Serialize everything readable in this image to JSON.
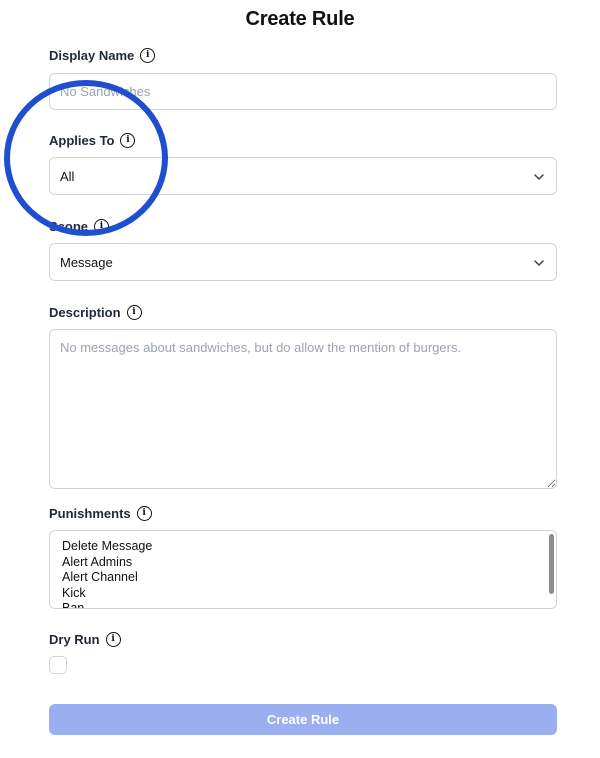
{
  "title": "Create Rule",
  "fields": {
    "display_name": {
      "label": "Display Name",
      "placeholder": "No Sandwiches",
      "value": ""
    },
    "applies_to": {
      "label": "Applies To",
      "value": "All"
    },
    "scope": {
      "label": "Scope",
      "value": "Message"
    },
    "description": {
      "label": "Description",
      "placeholder": "No messages about sandwiches, but do allow the mention of burgers."
    },
    "punishments": {
      "label": "Punishments",
      "options": [
        "Delete Message",
        "Alert Admins",
        "Alert Channel",
        "Kick",
        "Ban"
      ]
    },
    "dry_run": {
      "label": "Dry Run",
      "checked": false
    }
  },
  "submit_label": "Create Rule",
  "icons": {
    "info": "info-icon",
    "dropdown": "chevron-down-icon"
  },
  "colors": {
    "submit_bg": "#9aaef0",
    "annotation_circle": "#1f4fcf"
  }
}
